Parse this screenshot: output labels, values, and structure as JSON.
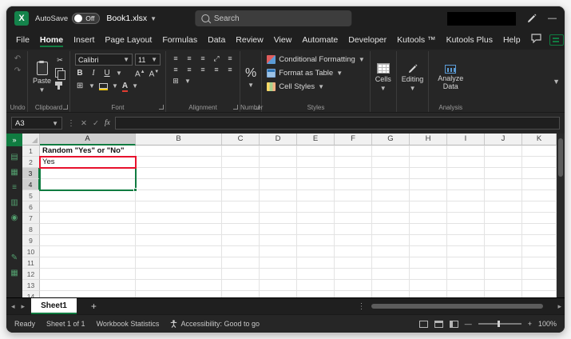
{
  "titlebar": {
    "autosave_label": "AutoSave",
    "autosave_state": "Off",
    "filename": "Book1.xlsx",
    "search_placeholder": "Search"
  },
  "menubar": {
    "items": [
      "File",
      "Home",
      "Insert",
      "Page Layout",
      "Formulas",
      "Data",
      "Review",
      "View",
      "Automate",
      "Developer",
      "Kutools ™",
      "Kutools Plus",
      "Help"
    ],
    "active_item": "Home"
  },
  "ribbon": {
    "undo": {
      "label": "Undo"
    },
    "clipboard": {
      "paste": "Paste",
      "label": "Clipboard"
    },
    "font": {
      "font_name": "Calibri",
      "font_size": "11",
      "bold": "B",
      "italic": "I",
      "underline": "U",
      "label": "Font"
    },
    "alignment": {
      "label": "Alignment"
    },
    "number": {
      "percent": "%",
      "label": "Number"
    },
    "styles": {
      "conditional_formatting": "Conditional Formatting",
      "format_as_table": "Format as Table",
      "cell_styles": "Cell Styles",
      "label": "Styles"
    },
    "cells": {
      "button": "Cells",
      "label": "Cells"
    },
    "editing": {
      "button": "Editing",
      "label": "Editing"
    },
    "analysis": {
      "button": "Analyze Data",
      "label": "Analysis"
    }
  },
  "formula_bar": {
    "name_box": "A3",
    "fx_label": "fx",
    "value": ""
  },
  "sidebar": {
    "icons": [
      "expand-pane",
      "clipboard-pane",
      "worksheets-pane",
      "navigation-list",
      "print-area",
      "find-tool",
      "edit-tool",
      "grid-tool"
    ]
  },
  "grid": {
    "columns": [
      "A",
      "B",
      "C",
      "D",
      "E",
      "F",
      "G",
      "H",
      "I",
      "J",
      "K"
    ],
    "row_count": 15,
    "cells": {
      "A1": "Random \"Yes\" or \"No\"",
      "A2": "Yes"
    },
    "bold_cells": [
      "A1"
    ],
    "selected_cell": "A3",
    "selection_range": "A3:A4",
    "highlighted_cell": "A2"
  },
  "sheet_tabs": {
    "active_tab": "Sheet1",
    "new_sheet": "+"
  },
  "status_bar": {
    "mode": "Ready",
    "sheet_info": "Sheet 1 of 1",
    "workbook_statistics": "Workbook Statistics",
    "accessibility": "Accessibility: Good to go",
    "zoom_level": "100%"
  },
  "colors": {
    "accent_green": "#107C41",
    "highlight_red": "#E8112D",
    "titlebar_bg": "#1F1F1F",
    "ribbon_bg": "#262626"
  }
}
